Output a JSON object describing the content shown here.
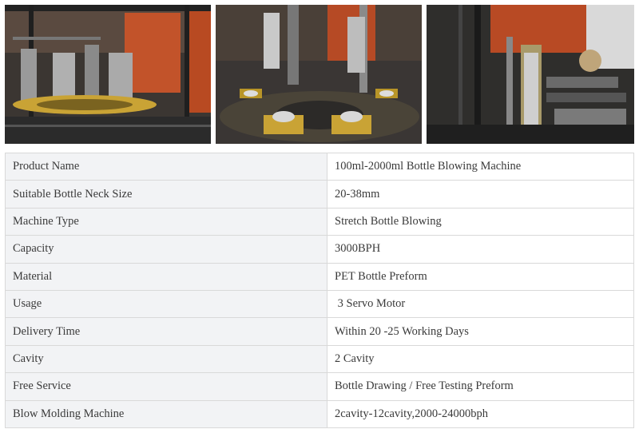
{
  "photos": [
    {
      "name": "machine-photo-frame-interior"
    },
    {
      "name": "machine-photo-preform-carousel"
    },
    {
      "name": "machine-photo-conveyor-line"
    }
  ],
  "specs": [
    {
      "label": "Product Name",
      "value": "100ml-2000ml Bottle Blowing Machine"
    },
    {
      "label": "Suitable Bottle Neck Size",
      "value": "20-38mm"
    },
    {
      "label": "Machine Type",
      "value": "Stretch Bottle Blowing"
    },
    {
      "label": "Capacity",
      "value": "3000BPH"
    },
    {
      "label": "Material",
      "value": "PET Bottle Preform"
    },
    {
      "label": "Usage",
      "value": " 3 Servo Motor"
    },
    {
      "label": "Delivery Time",
      "value": "Within 20 -25 Working Days"
    },
    {
      "label": "Cavity",
      "value": "2 Cavity"
    },
    {
      "label": "Free Service",
      "value": "Bottle Drawing / Free Testing Preform"
    },
    {
      "label": "Blow Molding Machine",
      "value": "2cavity-12cavity,2000-24000bph"
    }
  ]
}
